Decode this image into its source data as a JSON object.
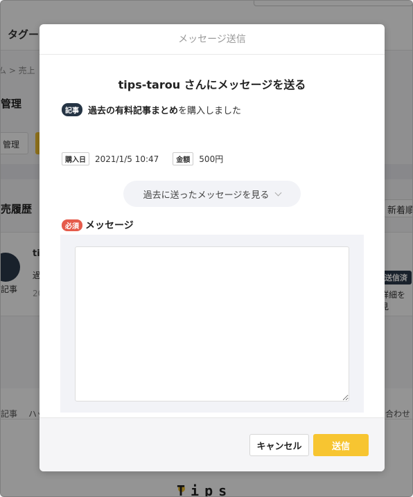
{
  "background": {
    "tag_label": "タグー",
    "breadcrumb": "ム > 売上",
    "manage_title": "管理",
    "manage_button": "管理",
    "history_title": "売履歴",
    "sort_button": "新着順",
    "row": {
      "icon_label": "記事",
      "title": "tip",
      "line2": "過",
      "line3": "20"
    },
    "sent_badge": "送信済",
    "detail_link": "詳細を見",
    "footer": {
      "link1": "記事",
      "link2": "ハッ",
      "link3": "合わせ"
    },
    "logo": "Tips"
  },
  "modal": {
    "title": "メッセージ送信",
    "heading": "tips-tarou さんにメッセージを送る",
    "article": {
      "badge": "記事",
      "title": "過去の有料記事まとめ",
      "suffix": "を購入しました"
    },
    "meta": {
      "purchase_label": "購入日",
      "purchase_value": "2021/1/5 10:47",
      "amount_label": "金額",
      "amount_value": "500円"
    },
    "past_messages_button": "過去に送ったメッセージを見る",
    "message": {
      "required_badge": "必須",
      "label": "メッセージ",
      "value": ""
    },
    "footer": {
      "cancel_label": "キャンセル",
      "send_label": "送信"
    }
  },
  "colors": {
    "accent": "#f7c531",
    "dark_badge": "#253444",
    "required": "#e55b4b"
  }
}
